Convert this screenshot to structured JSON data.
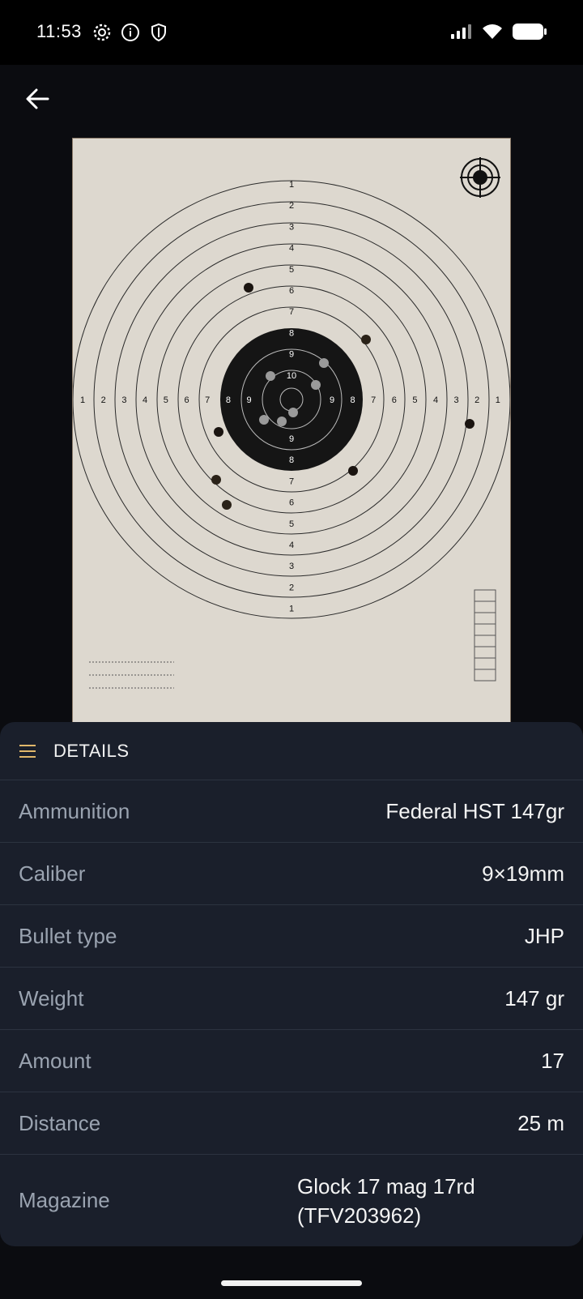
{
  "status_bar": {
    "time": "11:53",
    "icons": [
      "gear-icon",
      "info-icon",
      "shield-icon",
      "signal-icon",
      "wifi-icon",
      "battery-icon"
    ]
  },
  "navigation": {
    "back_icon": "arrow-left-icon"
  },
  "target_image": {
    "ring_numbers_top": [
      "1",
      "2",
      "3",
      "4",
      "5",
      "6",
      "7",
      "8",
      "9",
      "10"
    ],
    "ring_numbers_left": [
      "1",
      "2",
      "3",
      "4",
      "5",
      "6",
      "7",
      "8",
      "9"
    ],
    "ring_numbers_right": [
      "9",
      "8",
      "7",
      "6",
      "5",
      "4",
      "3",
      "2",
      "1"
    ],
    "ring_numbers_bottom": [
      "9",
      "8",
      "7",
      "6",
      "5",
      "4",
      "3",
      "2",
      "1"
    ]
  },
  "details": {
    "header_icon": "menu-icon",
    "title": "DETAILS",
    "rows": [
      {
        "label": "Ammunition",
        "value": "Federal HST 147gr"
      },
      {
        "label": "Caliber",
        "value": "9×19mm"
      },
      {
        "label": "Bullet type",
        "value": "JHP"
      },
      {
        "label": "Weight",
        "value": "147 gr"
      },
      {
        "label": "Amount",
        "value": "17"
      },
      {
        "label": "Distance",
        "value": "25 m"
      },
      {
        "label": "Magazine",
        "value": "Glock 17 mag 17rd (TFV203962)"
      }
    ]
  }
}
